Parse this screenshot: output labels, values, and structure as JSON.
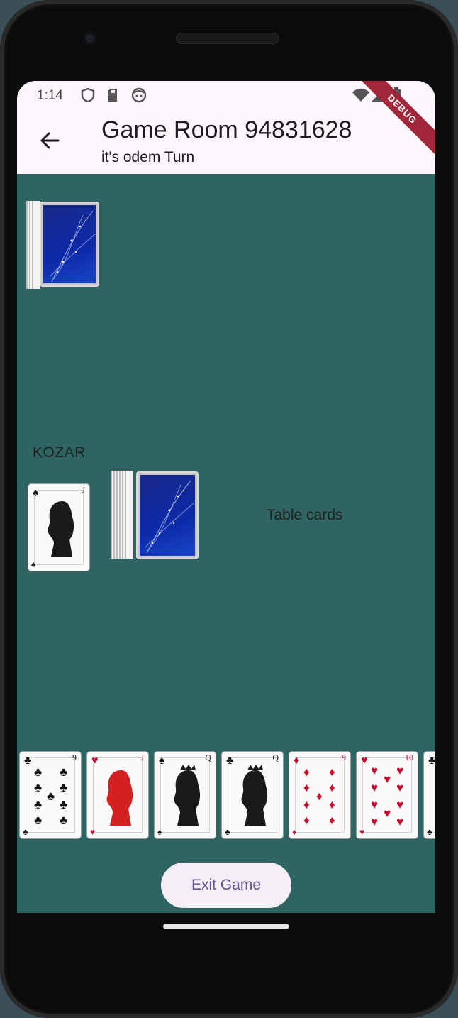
{
  "status": {
    "time": "1:14",
    "icons": [
      "shield-icon",
      "sd-card-icon",
      "face-icon",
      "wifi-icon",
      "signal-icon",
      "battery-icon"
    ]
  },
  "appbar": {
    "title": "Game Room 94831628",
    "subtitle": "it's odem Turn",
    "back_icon": "arrow-back-icon",
    "debug_banner": "DEBUG"
  },
  "table": {
    "background": "#2e6461",
    "kozar_label": "KOZAR",
    "table_label": "Table cards",
    "kozar_card": {
      "rank": "J",
      "suit": "♠",
      "color": "#111111"
    }
  },
  "hand": [
    {
      "rank": "9",
      "suit": "♣",
      "color": "#111111"
    },
    {
      "rank": "J",
      "suit": "♥",
      "color": "#c8102e"
    },
    {
      "rank": "Q",
      "suit": "♠",
      "color": "#111111"
    },
    {
      "rank": "Q",
      "suit": "♣",
      "color": "#111111"
    },
    {
      "rank": "9",
      "suit": "♦",
      "color": "#c8102e"
    },
    {
      "rank": "10",
      "suit": "♥",
      "color": "#c8102e"
    },
    {
      "rank": "",
      "suit": "♣",
      "color": "#111111"
    }
  ],
  "actions": {
    "exit_label": "Exit Game"
  }
}
